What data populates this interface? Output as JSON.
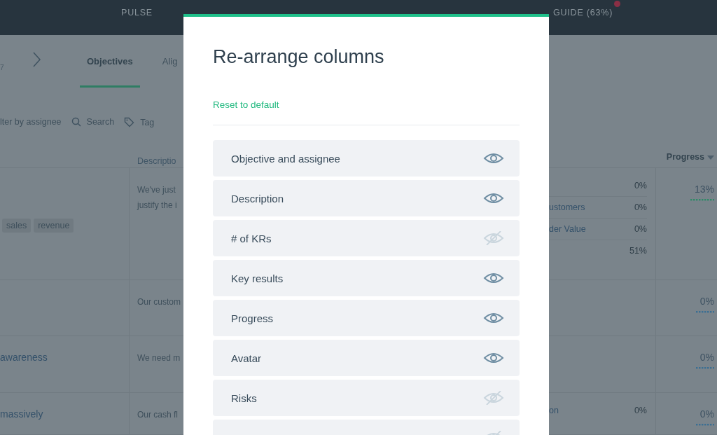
{
  "nav": [
    {
      "label": "PULSE"
    },
    {
      "label": "GUIDE (63%)"
    }
  ],
  "subheader": {
    "period": "7",
    "tabs": [
      {
        "label": "Objectives",
        "selected": true
      },
      {
        "label": "Alig",
        "selected": false
      }
    ]
  },
  "filters": [
    {
      "kind": "text",
      "label": "lter by assignee"
    },
    {
      "kind": "search",
      "label": "Search"
    },
    {
      "kind": "tag",
      "label": "Tag"
    }
  ],
  "table": {
    "columns": [
      {
        "label": "Descriptio"
      },
      {
        "label": "Progress"
      }
    ],
    "rows": [
      {
        "objective": "",
        "tags": [
          "sales",
          "revenue"
        ],
        "description": [
          "We've just",
          "justify the i"
        ],
        "key_results": [
          {
            "value": "0%"
          },
          {
            "name": "ustomers",
            "value": "0%"
          },
          {
            "name": "der Value",
            "value": "0%"
          },
          {
            "value": "51%"
          }
        ],
        "progress": "13%",
        "color": "#2f8a68"
      },
      {
        "objective": "",
        "tags": [],
        "description": [
          "Our custom"
        ],
        "key_results": [],
        "progress": "0%",
        "color": "#3b6f93"
      },
      {
        "objective": "awareness",
        "tags": [],
        "description": [
          "We need m"
        ],
        "key_results": [],
        "progress": "0%",
        "color": "#3b6f93"
      },
      {
        "objective": "massively",
        "tags": [],
        "description": [
          "Our cash fl"
        ],
        "key_results": [
          {
            "name": "on",
            "value": "0%"
          }
        ],
        "progress": "0%",
        "color": "#3b6f93"
      }
    ]
  },
  "modal": {
    "title": "Re-arrange columns",
    "reset": "Reset to default",
    "items": [
      {
        "label": "Objective and assignee",
        "visible": true
      },
      {
        "label": "Description",
        "visible": true
      },
      {
        "label": "# of KRs",
        "visible": false
      },
      {
        "label": "Key results",
        "visible": true
      },
      {
        "label": "Progress",
        "visible": true
      },
      {
        "label": "Avatar",
        "visible": true
      },
      {
        "label": "Risks",
        "visible": false
      },
      {
        "visible": false
      }
    ]
  }
}
